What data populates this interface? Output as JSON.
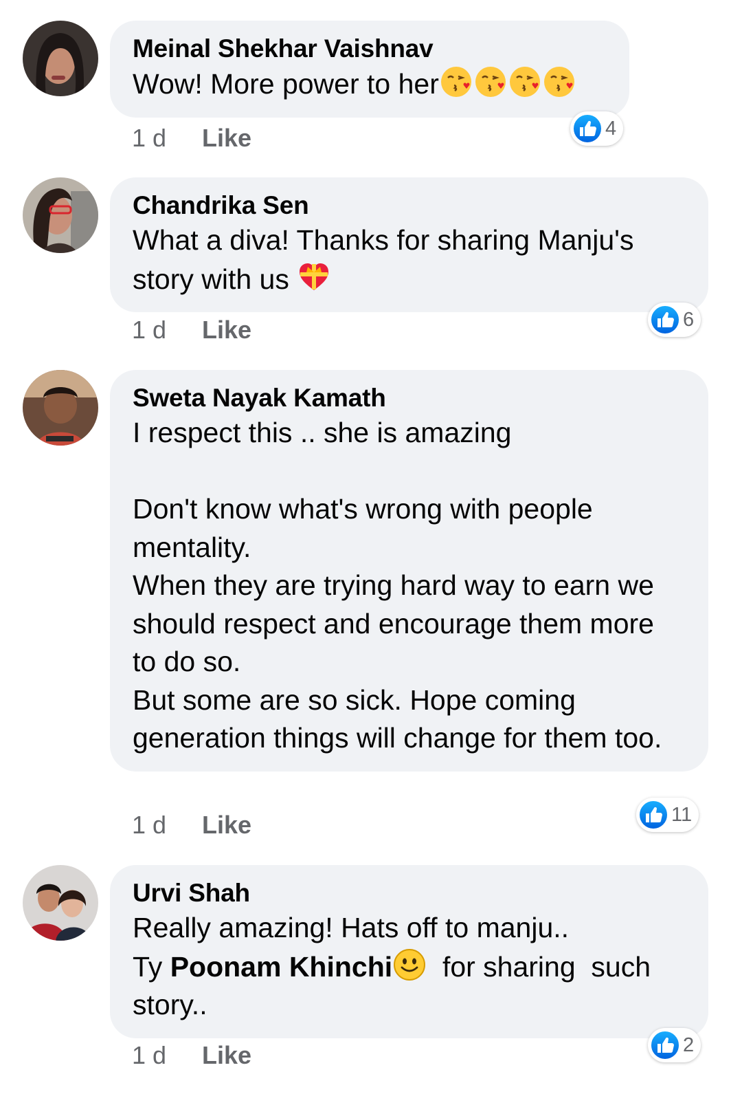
{
  "comments": [
    {
      "author": "Meinal Shekhar Vaishnav",
      "text": "Wow! More power to her",
      "emojis": [
        "face-blowing-kiss-emoji",
        "face-blowing-kiss-emoji",
        "face-blowing-kiss-emoji",
        "face-blowing-kiss-emoji"
      ],
      "time": "1 d",
      "like_label": "Like",
      "reaction_count": "4",
      "reaction_icon": "like-icon"
    },
    {
      "author": "Chandrika Sen",
      "text": "What a diva! Thanks for sharing Manju's story with us",
      "emojis": [
        "heart-with-ribbon-emoji"
      ],
      "time": "1 d",
      "like_label": "Like",
      "reaction_count": "6",
      "reaction_icon": "like-icon"
    },
    {
      "author": "Sweta Nayak Kamath",
      "text": "I respect this .. she is amazing\n\nDon't know what's wrong with people mentality.\nWhen they are trying hard way to earn we should respect and encourage them more to do so.\nBut some are so sick. Hope coming generation things will change for them too.",
      "time": "1 d",
      "like_label": "Like",
      "reaction_count": "11",
      "reaction_icon": "like-icon"
    },
    {
      "author": "Urvi Shah",
      "text_line1": "Really amazing! Hats off to manju..",
      "text_prefix": "Ty ",
      "mention": "Poonam Khinchi",
      "emoji": "smiling-face-emoji",
      "text_suffix": "  for sharing  such story..",
      "time": "1 d",
      "like_label": "Like",
      "reaction_count": "2",
      "reaction_icon": "like-icon"
    }
  ],
  "colors": {
    "bubble_bg": "#f0f2f5",
    "meta_text": "#65676b",
    "like_blue": "#1877f2"
  }
}
